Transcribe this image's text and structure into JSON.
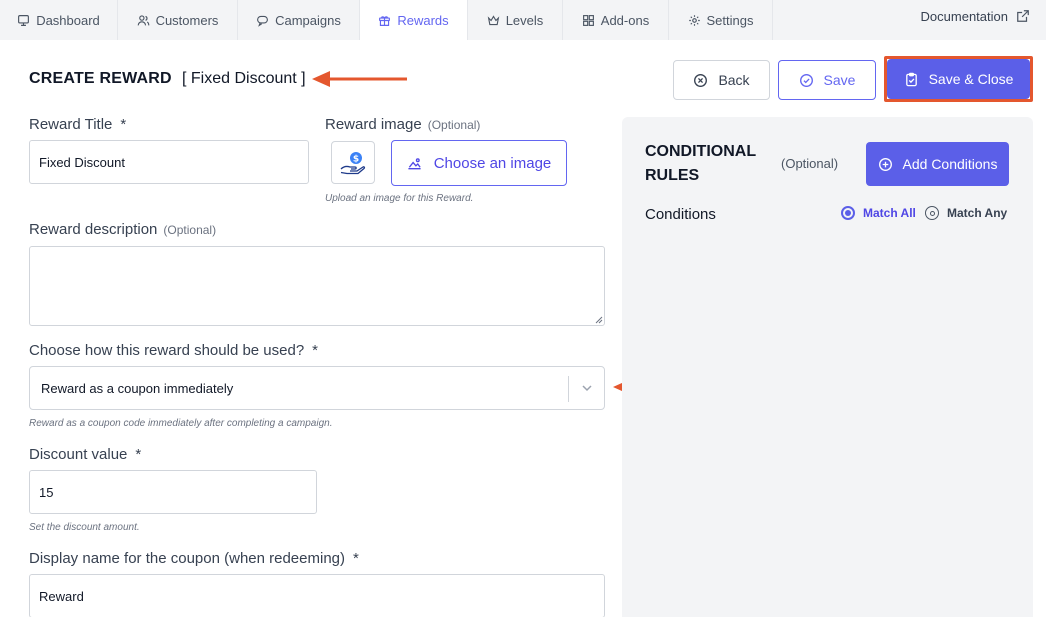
{
  "nav": {
    "tabs": [
      {
        "label": "Dashboard",
        "icon": "dashboard-icon"
      },
      {
        "label": "Customers",
        "icon": "users-icon"
      },
      {
        "label": "Campaigns",
        "icon": "campaigns-icon"
      },
      {
        "label": "Rewards",
        "icon": "gift-icon",
        "active": true
      },
      {
        "label": "Levels",
        "icon": "crown-icon"
      },
      {
        "label": "Add-ons",
        "icon": "grid-icon"
      },
      {
        "label": "Settings",
        "icon": "gear-icon"
      }
    ],
    "documentation": "Documentation"
  },
  "header": {
    "title": "CREATE REWARD",
    "subtitle": "[ Fixed Discount ]",
    "back_label": "Back",
    "save_label": "Save",
    "save_close_label": "Save & Close"
  },
  "form": {
    "reward_title": {
      "label": "Reward Title",
      "required": "*",
      "value": "Fixed Discount"
    },
    "reward_image": {
      "label": "Reward image",
      "optional": "(Optional)",
      "button": "Choose an image",
      "help": "Upload an image for this Reward."
    },
    "reward_description": {
      "label": "Reward description",
      "optional": "(Optional)",
      "value": ""
    },
    "usage": {
      "label": "Choose how this reward should be used?",
      "required": "*",
      "value": "Reward as a coupon immediately",
      "help": "Reward as a coupon code immediately after completing a campaign."
    },
    "discount_value": {
      "label": "Discount value",
      "required": "*",
      "value": "15",
      "help": "Set the discount amount."
    },
    "display_name": {
      "label": "Display name for the coupon (when redeeming)",
      "required": "*",
      "value": "Reward"
    }
  },
  "conditions": {
    "title": "CONDITIONAL RULES",
    "optional": "(Optional)",
    "add_button": "Add Conditions",
    "label": "Conditions",
    "match_all": "Match All",
    "match_any": "Match Any",
    "selected": "Match All"
  },
  "colors": {
    "accent": "#5b5fe8",
    "annotation": "#e4572e",
    "nav_bg": "#f3f4f6",
    "panel_bg": "#f3f4f6"
  }
}
